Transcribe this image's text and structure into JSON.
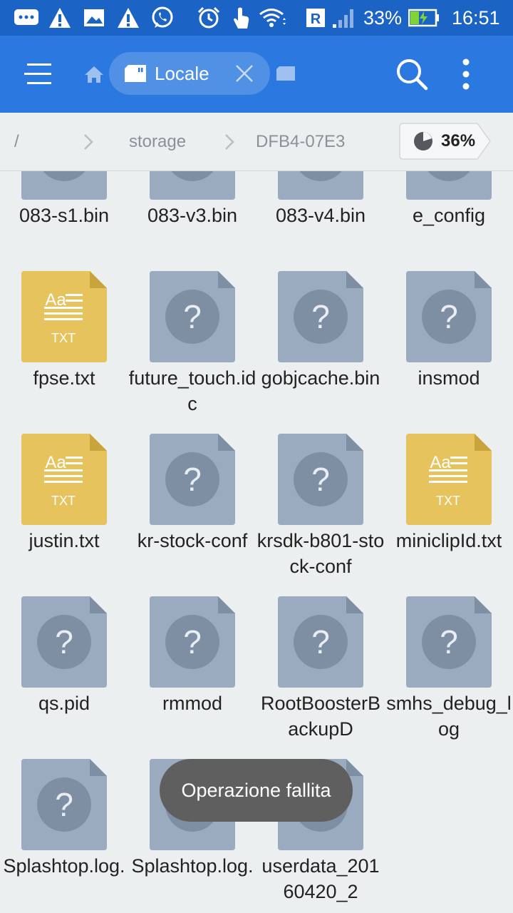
{
  "status_bar": {
    "battery_percent": "33%",
    "time": "16:51",
    "icons": [
      "messages-icon",
      "warning-icon",
      "gallery-icon",
      "warning-icon",
      "whatsapp-icon",
      "alarm-icon",
      "touch-icon",
      "wifi-icon",
      "roaming-r-icon",
      "signal-icon",
      "battery-charging-icon"
    ]
  },
  "toolbar": {
    "tab_label": "Locale",
    "icons": [
      "menu-icon",
      "home-icon",
      "sd-card-icon",
      "close-icon",
      "storage-icon",
      "search-icon",
      "more-vert-icon"
    ]
  },
  "breadcrumb": {
    "items": [
      "/",
      "storage",
      "DFB4-07E3"
    ],
    "usage": "36%"
  },
  "files": [
    {
      "name": "083-s1.bin",
      "type": "unknown"
    },
    {
      "name": "083-v3.bin",
      "type": "unknown"
    },
    {
      "name": "083-v4.bin",
      "type": "unknown"
    },
    {
      "name": "e_config",
      "type": "unknown"
    },
    {
      "name": "fpse.txt",
      "type": "txt"
    },
    {
      "name": "future_touch.idc",
      "type": "unknown"
    },
    {
      "name": "gobjcache.bin",
      "type": "unknown"
    },
    {
      "name": "insmod",
      "type": "unknown"
    },
    {
      "name": "justin.txt",
      "type": "txt"
    },
    {
      "name": "kr-stock-conf",
      "type": "unknown"
    },
    {
      "name": "krsdk-b801-stock-conf",
      "type": "unknown"
    },
    {
      "name": "miniclipId.txt",
      "type": "txt"
    },
    {
      "name": "qs.pid",
      "type": "unknown"
    },
    {
      "name": "rmmod",
      "type": "unknown"
    },
    {
      "name": "RootBoosterBackupD",
      "type": "unknown"
    },
    {
      "name": "smhs_debug_log",
      "type": "unknown"
    },
    {
      "name": "Splashtop.log.",
      "type": "unknown"
    },
    {
      "name": "Splashtop.log.",
      "type": "unknown"
    },
    {
      "name": "userdata_20160420_2",
      "type": "unknown"
    }
  ],
  "file_icon_labels": {
    "txt_top": "Aa",
    "txt_bottom": "TXT",
    "unknown": "?"
  },
  "toast": "Operazione fallita",
  "colors": {
    "status_bar": "#1b63c4",
    "toolbar": "#2b79e0",
    "unknown_file": "#9aabbf",
    "txt_file": "#e6c35c",
    "toast": "#5f5f5f"
  }
}
